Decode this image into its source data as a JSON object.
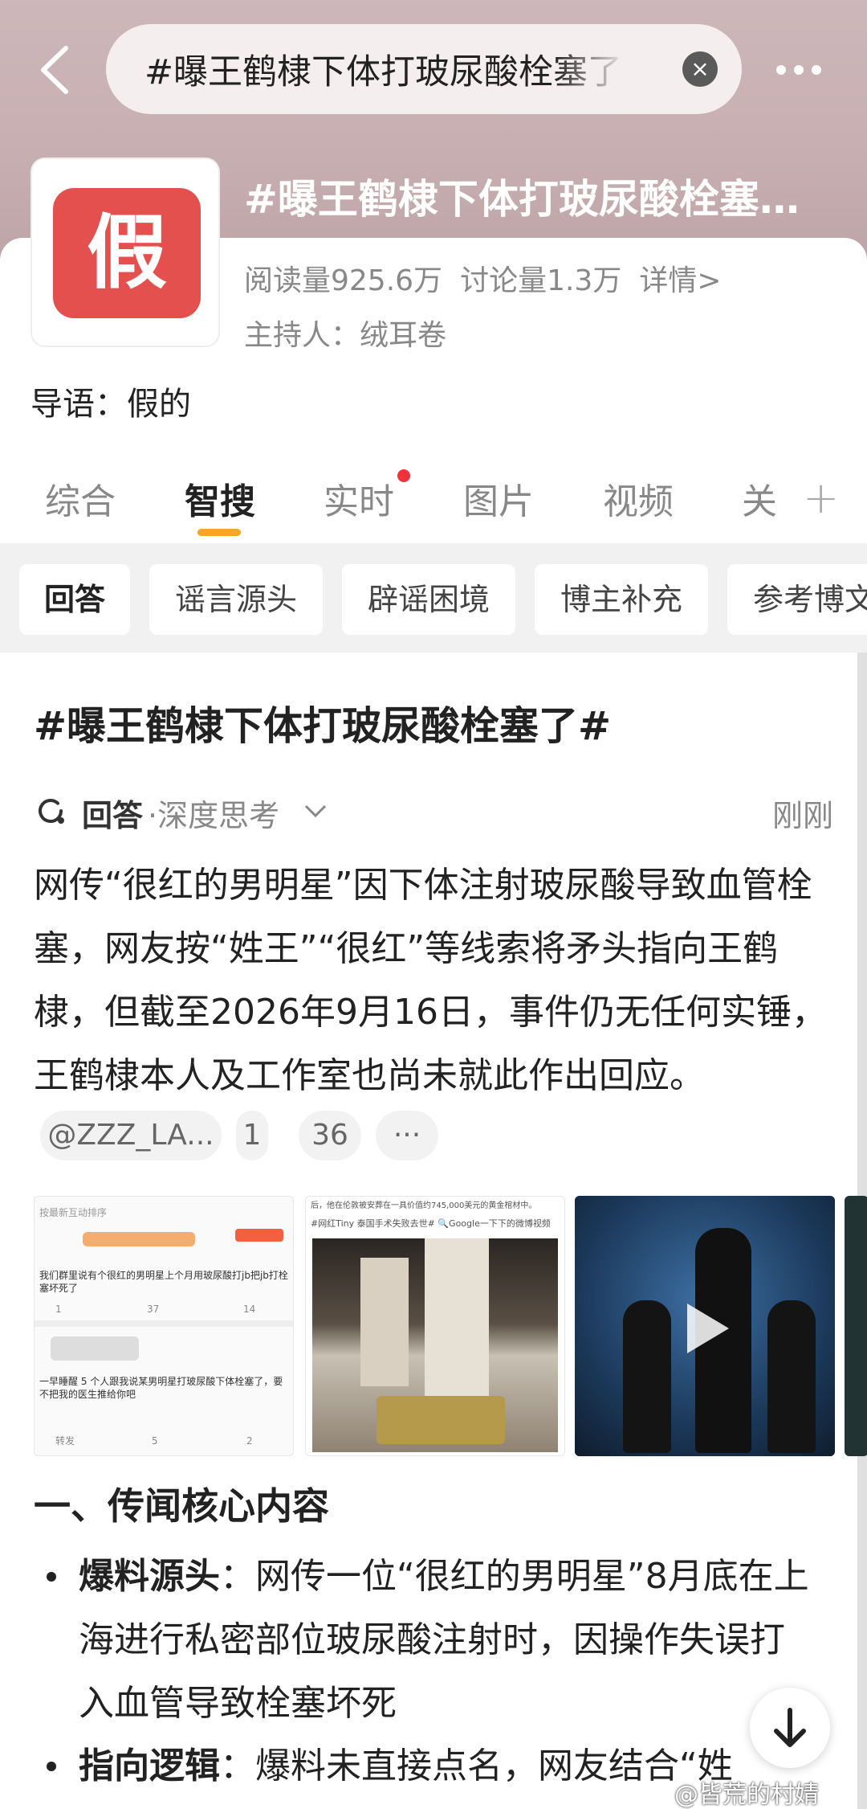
{
  "search": {
    "query": "#曝王鹤棣下体打玻尿酸栓塞了"
  },
  "topic": {
    "logo_char": "假",
    "title": "#曝王鹤棣下体打玻尿酸栓塞…",
    "reads": "阅读量925.6万",
    "discussions": "讨论量1.3万",
    "details": "详情>",
    "host": "主持人：绒耳卷",
    "intro": "导语：假的"
  },
  "tabs": [
    "综合",
    "智搜",
    "实时",
    "图片",
    "视频",
    "关"
  ],
  "chips": [
    "回答",
    "谣言源头",
    "辟谣困境",
    "博主补充",
    "参考博文"
  ],
  "content": {
    "title": "#曝王鹤棣下体打玻尿酸栓塞了#",
    "answer_label": "回答",
    "answer_sub": "·深度思考",
    "time": "刚刚",
    "paragraph": "网传“很红的男明星”因下体注射玻尿酸导致血管栓塞，网友按“姓王”“很红”等线索将矛头指向王鹤棣，但截至2026年9月16日，事件仍无任何实锤，王鹤棣本人及工作室也尚未就此作出回应。",
    "pills": [
      "@ZZZ_LA...",
      "1",
      "36",
      "···"
    ],
    "image1": {
      "header": "按最新互动排序",
      "post1": "我们群里说有个很红的男明星上个月用玻尿酸打jb把jb打栓塞坏死了",
      "post1_stats": [
        "1",
        "37",
        "14"
      ],
      "post2": "一早睡醒 5 个人跟我说某男明星打玻尿酸下体栓塞了，要不把我的医生推给你吧",
      "post2_stats": [
        "转发",
        "5",
        "2"
      ]
    },
    "image2": {
      "line1": "后，他在伦敦被安葬在一具价值约745,000美元的黄金棺材中。",
      "line2": "#网红Tiny 泰国手术失败去世# 🔍Google一下下的微博视频"
    },
    "section1": "一、传闻核心内容",
    "bullet1_label": "爆料源头",
    "bullet1_text": "：网传一位“很红的男明星”8月底在上海进行私密部位玻尿酸注射时，因操作失误打入血管导致栓塞坏死",
    "bullet2_label": "指向逻辑",
    "bullet2_text": "：爆料未直接点名，网友结合“姓"
  },
  "watermark": "@皆荒的村婧"
}
